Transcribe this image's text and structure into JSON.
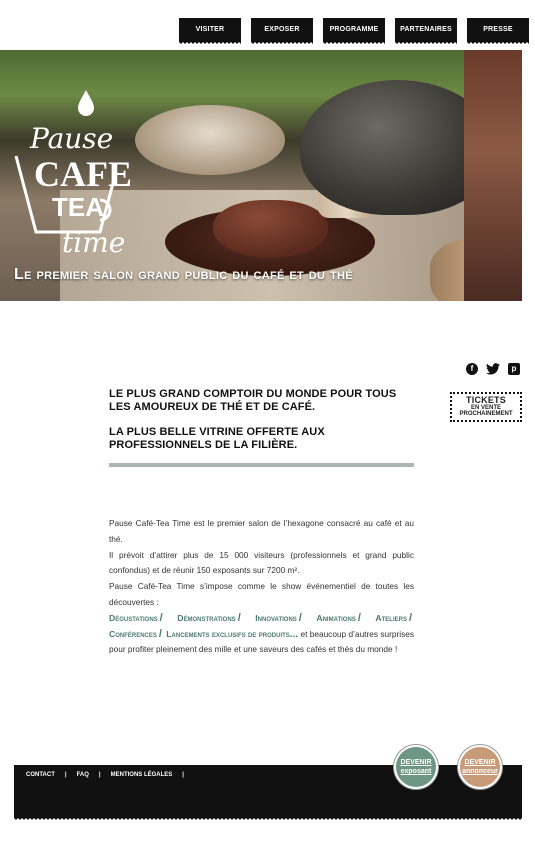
{
  "nav": {
    "items": [
      {
        "label": "VISITER"
      },
      {
        "label": "EXPOSER"
      },
      {
        "label": "PROGRAMME"
      },
      {
        "label": "PARTENAIRES"
      },
      {
        "label": "PRESSE"
      }
    ]
  },
  "hero": {
    "logo": {
      "line1": "Pause",
      "line2": "CAFE",
      "line3": "TEA",
      "line4": "time"
    },
    "tagline": "Le premier salon grand public du café et du thé"
  },
  "social": {
    "facebook": "f",
    "twitter": "twitter-icon",
    "pinterest": "p"
  },
  "tickets": {
    "line1": "TICKETS",
    "line2": "EN VENTE",
    "line3": "PROCHAINEMENT"
  },
  "headline": {
    "p1": "Le plus grand comptoir du monde pour tous les amoureux de thé et de café.",
    "p2": "La plus belle vitrine offerte aux professionnels de la filière."
  },
  "body": {
    "p1": "Pause Café-Tea Time est le premier salon de l’hexagone consacré au café et au thé.",
    "p2": "Il prévoit d’attirer plus de 15 000 visiteurs (professionnels et grand public confondus) et de réunir 150 exposants sur  7200 m².",
    "p3": "Pause Café-Tea Time s’impose comme le show événementiel de toutes les découvertes :",
    "tags": [
      "Dégustations",
      "Démonstrations",
      "Innovations",
      "Animations",
      "Ateliers",
      "Conférences",
      "Lancements exclusifs de produits"
    ],
    "dots": "...",
    "p4": " et beaucoup d’autres surprises pour profiter pleinement des mille et une saveurs des cafés et thés du monde !"
  },
  "footer": {
    "links": [
      {
        "label": "CONTACT"
      },
      {
        "label": "FAQ"
      },
      {
        "label": "MENTIONS LÉGALES"
      }
    ],
    "separator": "|"
  },
  "cta": {
    "exposant": {
      "line1": "DEVENIR",
      "line2": "exposant"
    },
    "annonceur": {
      "line1": "DEVENIR",
      "line2": "annonceur"
    }
  }
}
